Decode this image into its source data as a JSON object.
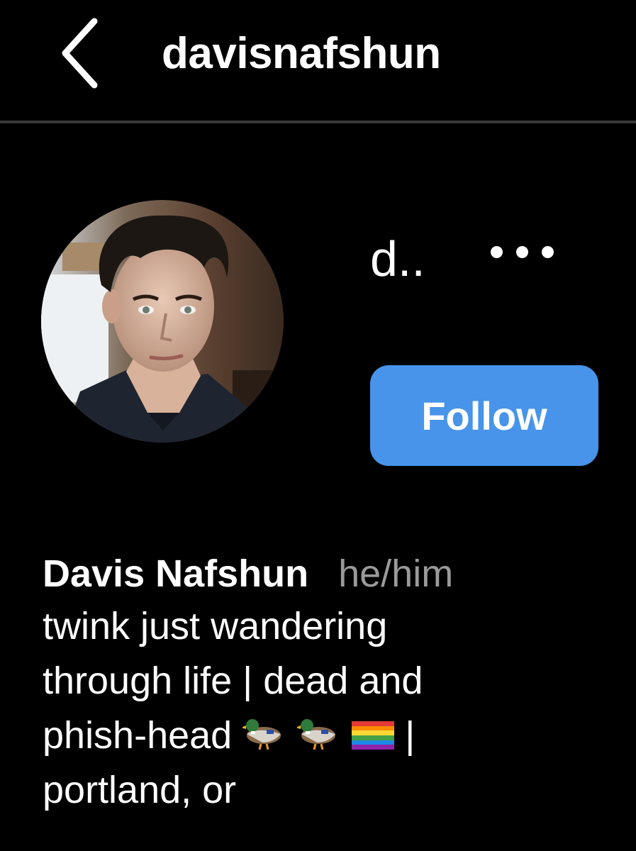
{
  "header": {
    "username": "davisnafshun"
  },
  "profile": {
    "display_short": "d..",
    "follow_label": "Follow",
    "full_name": "Davis Nafshun",
    "pronouns": "he/him",
    "bio_lines": [
      "twink just wandering",
      "through life | dead and",
      "phish-head",
      "|",
      "portland, or"
    ],
    "bio_emojis": [
      "duck",
      "duck",
      "rainbow-flag"
    ]
  },
  "colors": {
    "background": "#000000",
    "follow_button": "#4794ea",
    "pronouns_text": "#9a9a9a",
    "divider": "#3a3a3a"
  }
}
